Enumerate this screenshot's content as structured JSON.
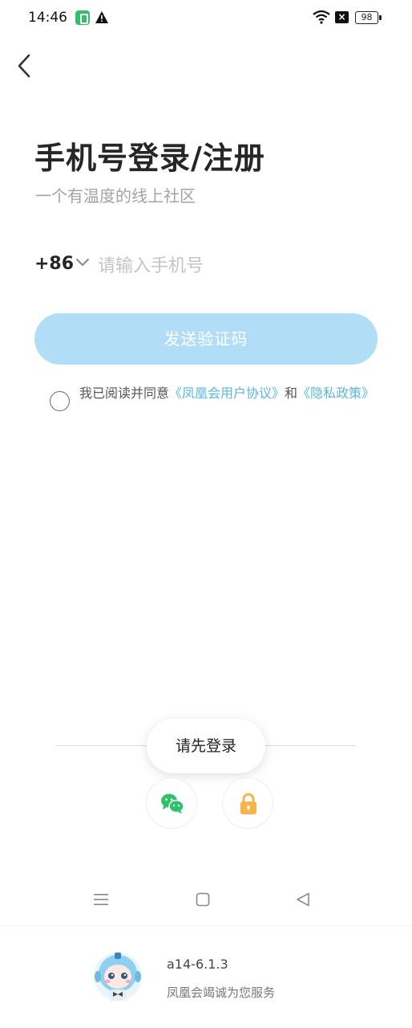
{
  "status_bar": {
    "time": "14:46",
    "battery": "98",
    "icons": [
      "app-notification-icon",
      "warning-icon",
      "wifi-icon",
      "sim-disabled-icon",
      "battery-icon"
    ]
  },
  "header": {
    "back_icon": "chevron-left-icon"
  },
  "login": {
    "title": "手机号登录/注册",
    "subtitle": "一个有温度的线上社区",
    "country_code": "+86",
    "phone_placeholder": "请输入手机号",
    "send_code_label": "发送验证码",
    "agreement": {
      "prefix": "我已阅读并同意",
      "user_agreement": "《凤凰会用户协议》",
      "conjunction": "和",
      "privacy_policy": "《隐私政策》"
    }
  },
  "toast": {
    "message": "请先登录"
  },
  "alt_login": {
    "wechat_icon": "wechat-icon",
    "password_icon": "lock-icon"
  },
  "nav": {
    "icons": [
      "menu-icon",
      "home-icon",
      "back-icon"
    ]
  },
  "footer": {
    "version": "a14-6.1.3",
    "slogan": "凤凰会竭诚为您服务"
  },
  "colors": {
    "accent": "#5ab6dd",
    "button_bg": "#b1def6",
    "wechat_green": "#2dc26b",
    "lock_orange": "#f6b44b"
  }
}
